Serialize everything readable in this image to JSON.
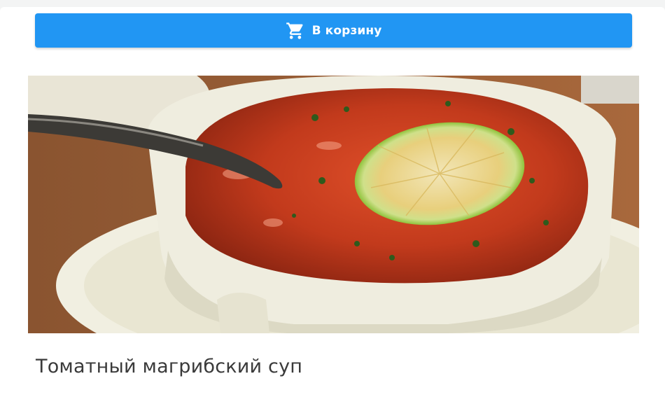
{
  "cart": {
    "label": "В корзину",
    "icon": "shopping-cart-icon"
  },
  "dish": {
    "title": "Томатный магрибский суп",
    "image_alt": "soup-photo"
  },
  "colors": {
    "accent": "#2196f3",
    "background": "#f3f4f4",
    "card": "#ffffff",
    "title_text": "#3a3a3a"
  }
}
